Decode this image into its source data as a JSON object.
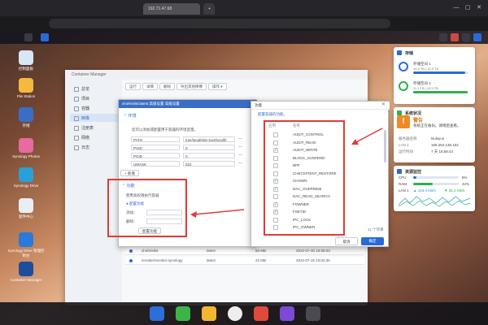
{
  "browser": {
    "tab_title": "192.71.47.68",
    "address": "",
    "win_min": "—",
    "win_max": "▢",
    "win_close": "✕"
  },
  "desktop_icons": [
    {
      "label": "控制面板",
      "color": "#d9e6f5"
    },
    {
      "label": "File Station",
      "color": "#f5b942"
    },
    {
      "label": "存储",
      "color": "#3a6ec6"
    },
    {
      "label": "Synology Photos",
      "color": "#e86aa2"
    },
    {
      "label": "Synology Drive",
      "color": "#2aa0d8"
    },
    {
      "label": "套件中心",
      "color": "#e9eef5"
    },
    {
      "label": "Synology Drive 管理控制台",
      "color": "#2a7ad8"
    },
    {
      "label": "Container Manager",
      "color": "#1d4d9e"
    }
  ],
  "cm": {
    "title": "Container Manager",
    "sidebar": [
      "总览",
      "项目",
      "容器",
      "映像",
      "注册表",
      "网络",
      "日志"
    ],
    "toolbar": [
      "运行",
      "详情",
      "删除",
      "导出其他映像",
      "操作 ▾"
    ],
    "rows": [
      {
        "name": "xhofe/alist",
        "tag": "latest",
        "size": "56 MB",
        "date": "2022-07-30 16:06:03"
      },
      {
        "name": "zerotier/zerotier-synology",
        "tag": "latest",
        "size": "22 MB",
        "date": "2022-07-15 10:04:35"
      }
    ]
  },
  "settings": {
    "header": "xhofe/alist:latest  高级设置  高级设置",
    "env_title": "环境",
    "env_desc": "您可以添加或配置用于容器的环境变量。",
    "env": [
      {
        "key": "PATH",
        "value": "/usr/local/sbin:/usr/local/b"
      },
      {
        "key": "PUID",
        "value": "0"
      },
      {
        "key": "PGID",
        "value": "0"
      },
      {
        "key": "UMASK",
        "value": "022"
      }
    ],
    "add_label": "+ 新增",
    "func_title": "功能",
    "func_use": "使用高权限执行容器",
    "func_cap": "● 配置功能",
    "func_add": "添加：",
    "func_remove": "删除：",
    "cfg_button": "配置功能"
  },
  "cap": {
    "title": "功能",
    "desc": "配置容器的功能。",
    "head_enable": "启用",
    "head_name": "名称",
    "items": [
      {
        "name": "AUDIT_CONTROL",
        "checked": false
      },
      {
        "name": "AUDIT_READ",
        "checked": false
      },
      {
        "name": "AUDIT_WRITE",
        "checked": true
      },
      {
        "name": "BLOCK_SUSPEND",
        "checked": false
      },
      {
        "name": "BPF",
        "checked": false
      },
      {
        "name": "CHECKPOINT_RESTORE",
        "checked": false
      },
      {
        "name": "CHOWN",
        "checked": true
      },
      {
        "name": "DAC_OVERRIDE",
        "checked": true
      },
      {
        "name": "DAC_READ_SEARCH",
        "checked": false
      },
      {
        "name": "FOWNER",
        "checked": true
      },
      {
        "name": "FSETID",
        "checked": true
      },
      {
        "name": "IPC_LOCK",
        "checked": false
      },
      {
        "name": "IPC_OWNER",
        "checked": false
      }
    ],
    "count": "41 个项目",
    "cancel": "取消",
    "ok": "确定"
  },
  "widgets": {
    "storage_title": "存储",
    "pools": [
      {
        "name": "存储空间 1",
        "usage": "10.3 TB | 10.9 TB",
        "fill": 0.94,
        "color": "#2a6ad8"
      },
      {
        "name": "存储空间 2",
        "usage": "11.1 TB | 10.9 TB",
        "fill": 0.98,
        "color": "#2bb24c"
      }
    ],
    "health_title": "系统状况",
    "health_status": "警告",
    "health_msg": "系统正在备份。请稍后查看。",
    "health_kv": [
      {
        "k": "服务器名称",
        "v": "Nulsyun"
      },
      {
        "k": "LAN 1",
        "v": "169.254.136.152"
      },
      {
        "k": "运行时间",
        "v": "7 天 18:58:44"
      }
    ],
    "monitor_title": "资源监控",
    "cpu_label": "CPU",
    "cpu_val": "8%",
    "cpu_fill": 0.08,
    "ram_label": "RAM",
    "ram_val": "42%",
    "ram_fill": 0.42,
    "net_label": "LAN 1",
    "net_up": "▲ 183.4 KB/s",
    "net_down": "▼ 35.2 KB/s",
    "net_up_color": "#2a9ad8",
    "net_down_color": "#2bb24c"
  }
}
